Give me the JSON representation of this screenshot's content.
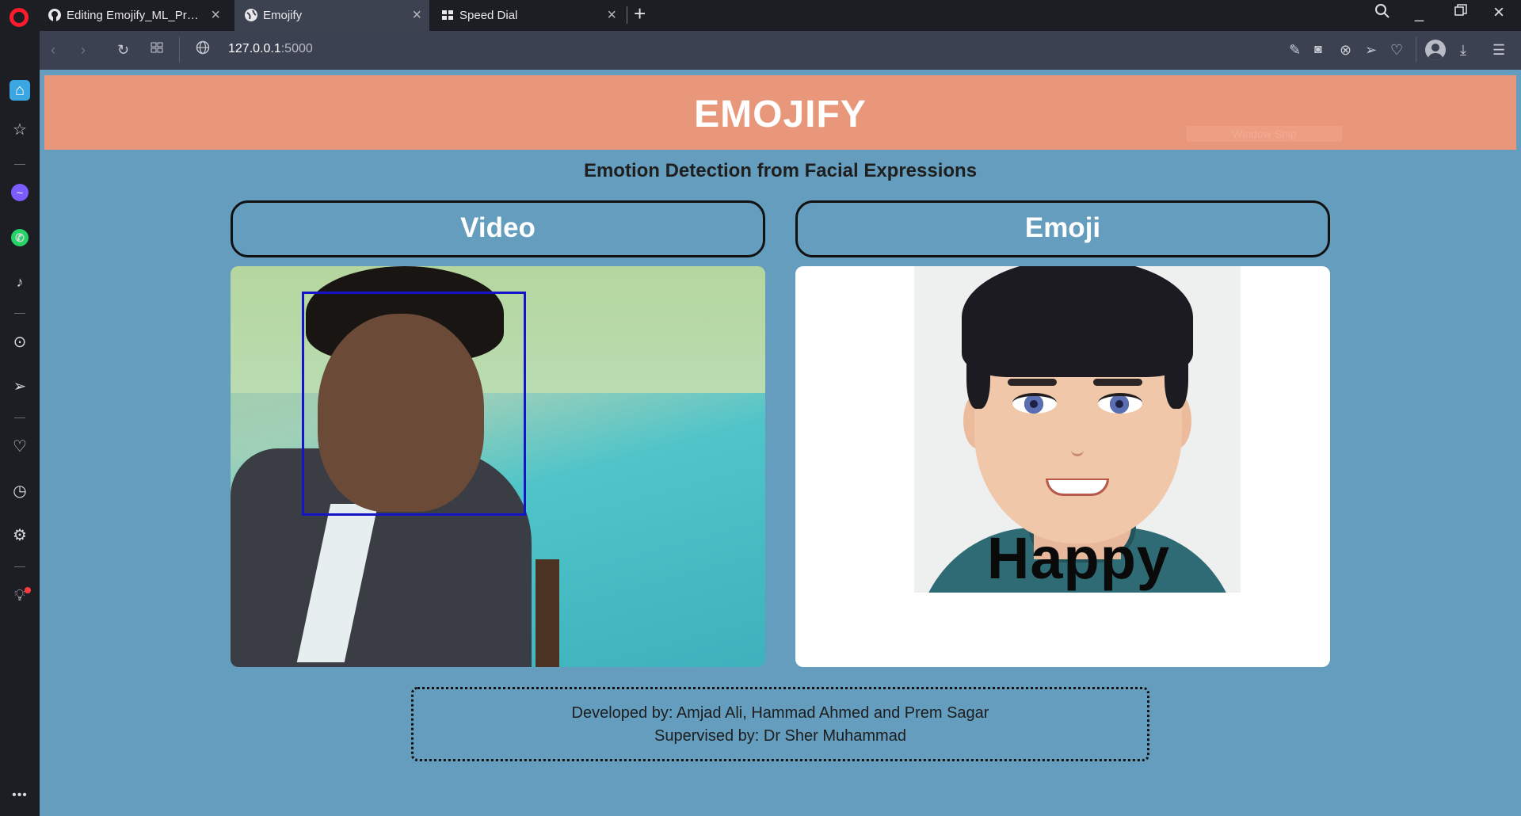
{
  "browser": {
    "tabs": [
      {
        "label": "Editing Emojify_ML_Project",
        "icon": "github-icon",
        "active": false
      },
      {
        "label": "Emojify",
        "icon": "globe-icon",
        "active": true
      },
      {
        "label": "Speed Dial",
        "icon": "grid-icon",
        "active": false
      }
    ],
    "address": {
      "host": "127.0.0.1",
      "port": ":5000"
    }
  },
  "page": {
    "title": "EMOJIFY",
    "overlay_text": "Window Snip",
    "subtitle": "Emotion Detection from Facial Expressions",
    "video_label": "Video",
    "emoji_label": "Emoji",
    "detected_emotion": "Happy",
    "credits": {
      "developed_by": "Developed by: Amjad Ali, Hammad Ahmed and Prem Sagar",
      "supervised_by": "Supervised by: Dr Sher Muhammad"
    }
  },
  "colors": {
    "header_bg": "#e8977a",
    "page_bg": "#649dbd",
    "face_box": "#1414c8",
    "browser_chrome": "#1c1e24",
    "address_bar": "#3b4150"
  }
}
